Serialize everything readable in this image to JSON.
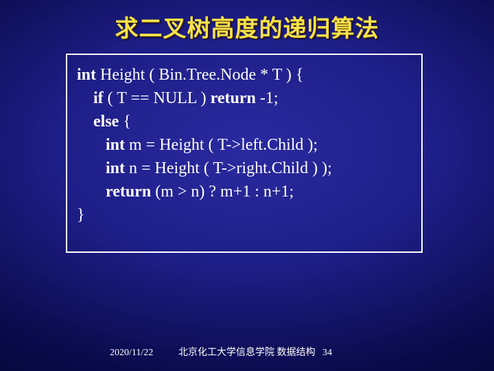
{
  "title": "求二叉树高度的递归算法",
  "code": {
    "l1a": "int",
    "l1b": " Height ( Bin.Tree.Node * T ) {",
    "l2a": "if",
    "l2b": " ( T == NULL ) ",
    "l2c": "return",
    "l2d": " -1;",
    "l3a": "else",
    "l3b": " {",
    "l4a": "int",
    "l4b": " m = Height ( T->left.Child );",
    "l5a": "int",
    "l5b": " n = Height ( T->right.Child ) );",
    "l6a": "return",
    "l6b": " (m > n) ? m+1 : n+1;",
    "l7": "}"
  },
  "footer": {
    "date": "2020/11/22",
    "org": "北京化工大学信息学院  数据结构",
    "pagenum": "34"
  }
}
